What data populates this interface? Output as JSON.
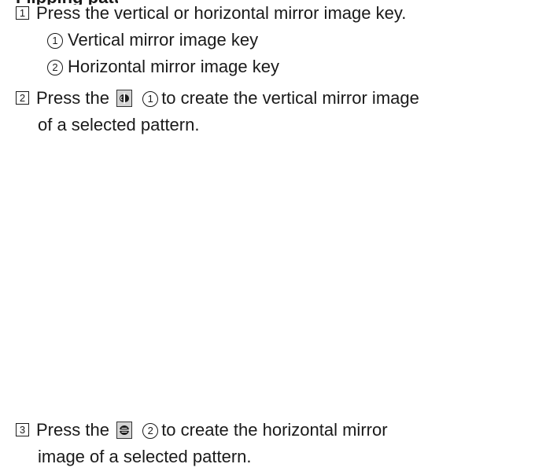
{
  "steps": [
    {
      "number": "1",
      "text": "Press the vertical or horizontal mirror image key.",
      "subitems": [
        {
          "marker": "1",
          "text": "Vertical mirror image key"
        },
        {
          "marker": "2",
          "text": "Horizontal mirror image key"
        }
      ]
    },
    {
      "number": "2",
      "before": "Press the",
      "key_icon": "vertical-mirror-key-icon",
      "ref": "1",
      "after": "to create the vertical mirror image",
      "line2": "of a selected pattern."
    },
    {
      "number": "3",
      "before": "Press the",
      "key_icon": "horizontal-mirror-key-icon",
      "ref": "2",
      "after": "to create the horizontal mirror",
      "line2": "image of a selected pattern."
    }
  ]
}
